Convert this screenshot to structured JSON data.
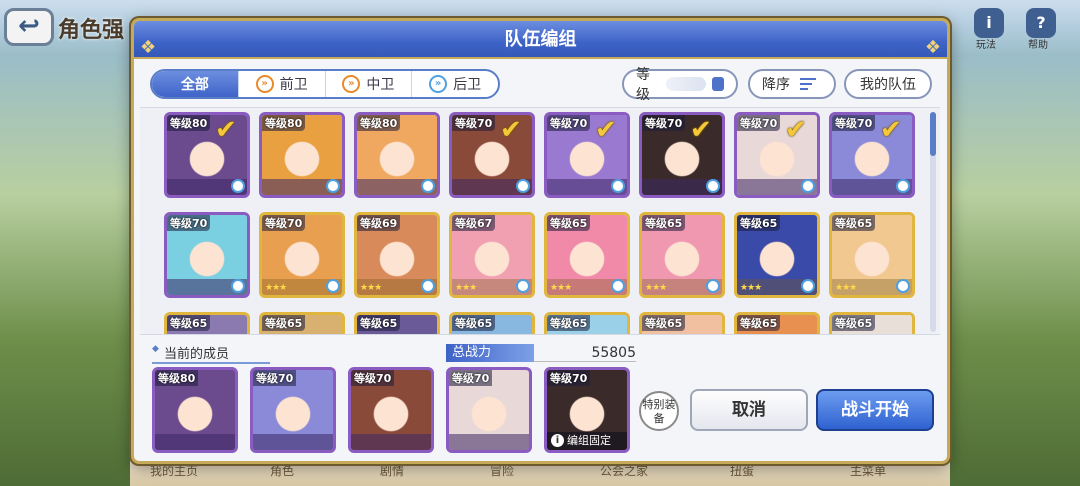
{
  "background": {
    "title": "角色强",
    "right_icons": [
      {
        "glyph": "i",
        "label": "玩法"
      },
      {
        "glyph": "?",
        "label": "帮助"
      }
    ],
    "bottom_nav": [
      "我的主页",
      "角色",
      "剧情",
      "冒险",
      "公会之家",
      "扭蛋",
      "主菜单"
    ]
  },
  "dialog": {
    "title": "队伍编组",
    "tabs": [
      {
        "label": "全部",
        "active": true,
        "icon": ""
      },
      {
        "label": "前卫",
        "active": false,
        "icon": "front-icon"
      },
      {
        "label": "中卫",
        "active": false,
        "icon": "middle-icon"
      },
      {
        "label": "后卫",
        "active": false,
        "icon": "back-icon"
      }
    ],
    "level_filter": "等级",
    "sort_label": "降序",
    "my_team_label": "我的队伍",
    "roster": [
      {
        "level": "等级80",
        "selected": true,
        "rarity": "purple",
        "color": "#6b4a8e"
      },
      {
        "level": "等级80",
        "selected": false,
        "rarity": "purple",
        "color": "#e8a040"
      },
      {
        "level": "等级80",
        "selected": false,
        "rarity": "purple",
        "color": "#f0a860"
      },
      {
        "level": "等级70",
        "selected": true,
        "rarity": "purple",
        "color": "#8a4a3a"
      },
      {
        "level": "等级70",
        "selected": true,
        "rarity": "purple",
        "color": "#9a7ad0"
      },
      {
        "level": "等级70",
        "selected": true,
        "rarity": "purple",
        "color": "#3a2a2a"
      },
      {
        "level": "等级70",
        "selected": true,
        "rarity": "purple",
        "color": "#e8d8d8"
      },
      {
        "level": "等级70",
        "selected": true,
        "rarity": "purple",
        "color": "#8a8ad8"
      },
      {
        "level": "等级70",
        "selected": false,
        "rarity": "purple",
        "color": "#7ad0e0"
      },
      {
        "level": "等级70",
        "selected": false,
        "rarity": "gold",
        "color": "#e8a050"
      },
      {
        "level": "等级69",
        "selected": false,
        "rarity": "gold",
        "color": "#d88a5a"
      },
      {
        "level": "等级67",
        "selected": false,
        "rarity": "gold",
        "color": "#f0a0b0"
      },
      {
        "level": "等级65",
        "selected": false,
        "rarity": "gold",
        "color": "#f08aa8"
      },
      {
        "level": "等级65",
        "selected": false,
        "rarity": "gold",
        "color": "#f098b0"
      },
      {
        "level": "等级65",
        "selected": false,
        "rarity": "gold",
        "color": "#3a4aa8"
      },
      {
        "level": "等级65",
        "selected": false,
        "rarity": "gold",
        "color": "#f0c890"
      },
      {
        "level": "等级65",
        "selected": false,
        "rarity": "gold",
        "color": "#8a7ab0"
      },
      {
        "level": "等级65",
        "selected": false,
        "rarity": "gold",
        "color": "#d8b070"
      },
      {
        "level": "等级65",
        "selected": false,
        "rarity": "gold",
        "color": "#6a5a98"
      },
      {
        "level": "等级65",
        "selected": false,
        "rarity": "gold",
        "color": "#88b8e0"
      },
      {
        "level": "等级65",
        "selected": false,
        "rarity": "gold",
        "color": "#9ad0e8"
      },
      {
        "level": "等级65",
        "selected": false,
        "rarity": "gold",
        "color": "#f0c0a0"
      },
      {
        "level": "等级65",
        "selected": false,
        "rarity": "gold",
        "color": "#e89050"
      },
      {
        "level": "等级65",
        "selected": false,
        "rarity": "gold",
        "color": "#e8e0d8"
      }
    ],
    "current_members_label": "当前的成员",
    "power_label": "总战力",
    "power_value": "55805",
    "members": [
      {
        "level": "等级80",
        "color": "#6b4a8e",
        "locked": false
      },
      {
        "level": "等级70",
        "color": "#8a8ad8",
        "locked": false
      },
      {
        "level": "等级70",
        "color": "#8a4a3a",
        "locked": false
      },
      {
        "level": "等级70",
        "color": "#e8d8d8",
        "locked": false
      },
      {
        "level": "等级70",
        "color": "#3a2a2a",
        "locked": true,
        "locked_label": "编组固定"
      }
    ],
    "special_equip_label": "特别装备",
    "cancel_label": "取消",
    "start_label": "战斗开始"
  }
}
